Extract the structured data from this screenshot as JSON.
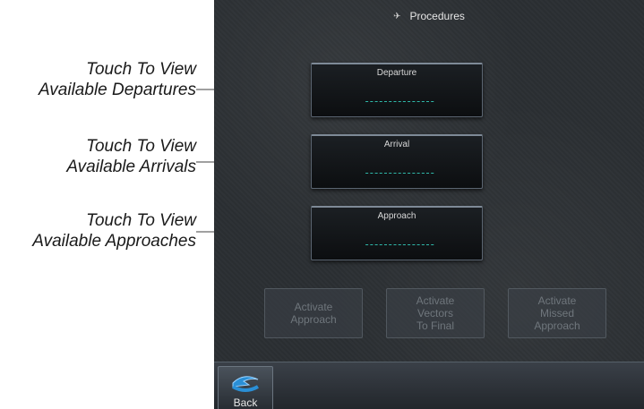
{
  "annotations": [
    {
      "line1": "Touch To View",
      "line2": "Available Departures"
    },
    {
      "line1": "Touch To View",
      "line2": "Available Arrivals"
    },
    {
      "line1": "Touch To View",
      "line2": "Available Approaches"
    }
  ],
  "header": {
    "title": "Procedures"
  },
  "procedures": {
    "departure": {
      "label": "Departure",
      "value": "---------------"
    },
    "arrival": {
      "label": "Arrival",
      "value": "---------------"
    },
    "approach": {
      "label": "Approach",
      "value": "---------------"
    }
  },
  "actions": {
    "activate_approach": [
      "Activate",
      "Approach"
    ],
    "activate_vectors": [
      "Activate",
      "Vectors",
      "To Final"
    ],
    "activate_missed": [
      "Activate",
      "Missed",
      "Approach"
    ]
  },
  "footer": {
    "back_label": "Back"
  },
  "colors": {
    "dash": "#2fb8a8",
    "disabled_text": "#6f767c",
    "screen_bg": "#2b2f33"
  },
  "icons": {
    "title": "procedures-icon",
    "back": "back-arrow-icon"
  }
}
